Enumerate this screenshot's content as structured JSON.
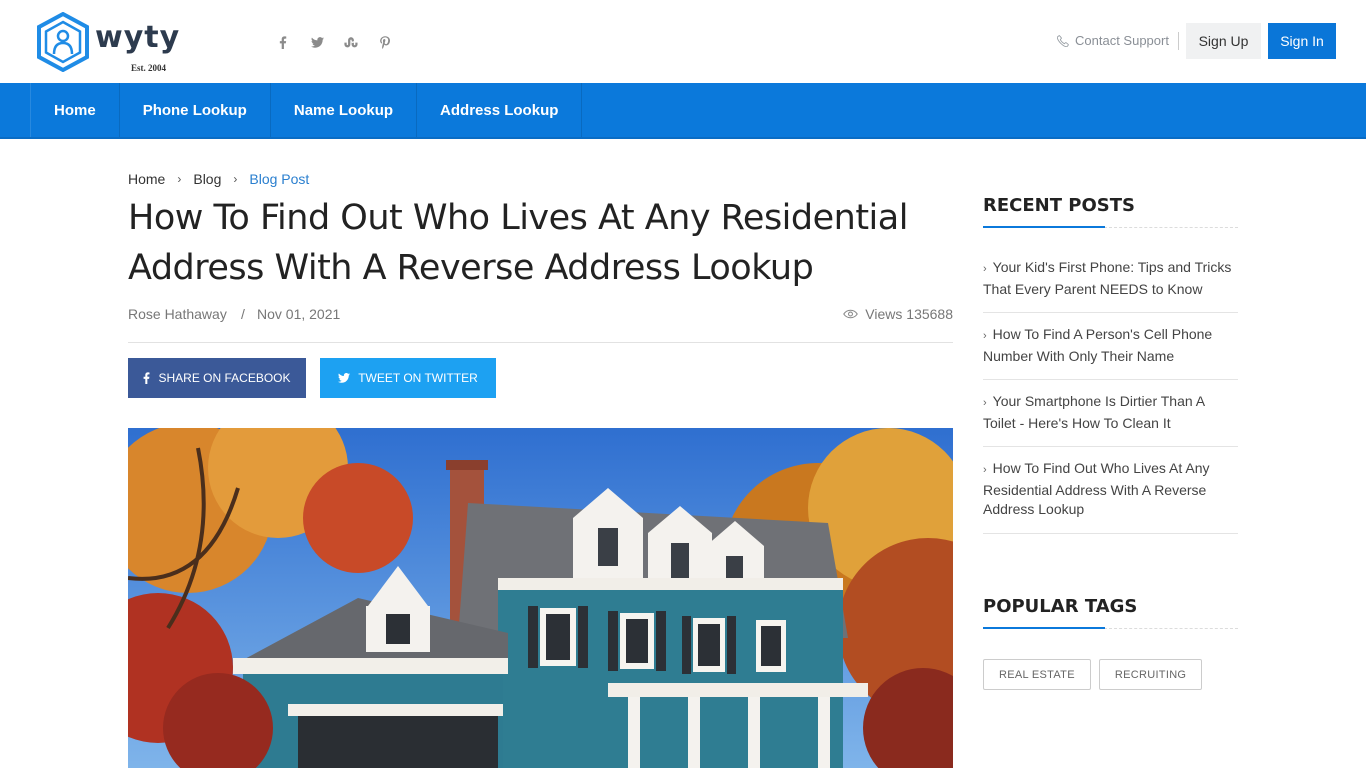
{
  "header": {
    "logo_text": "wyty",
    "logo_est": "Est. 2004",
    "socials": [
      "facebook-icon",
      "twitter-icon",
      "stumbleupon-icon",
      "pinterest-icon"
    ],
    "contact_label": "Contact Support",
    "signup_label": "Sign Up",
    "signin_label": "Sign In"
  },
  "nav": {
    "items": [
      {
        "label": "Home"
      },
      {
        "label": "Phone Lookup"
      },
      {
        "label": "Name Lookup"
      },
      {
        "label": "Address Lookup"
      }
    ]
  },
  "breadcrumb": {
    "items": [
      {
        "label": "Home"
      },
      {
        "label": "Blog"
      },
      {
        "label": "Blog Post"
      }
    ]
  },
  "article": {
    "title": "How To Find Out Who Lives At Any Residential Address With A Reverse Address Lookup",
    "author": "Rose Hathaway",
    "separator": "/",
    "date": "Nov 01, 2021",
    "views": "Views 135688",
    "share_facebook": "SHARE ON FACEBOOK",
    "share_twitter": "TWEET ON TWITTER"
  },
  "sidebar": {
    "recent_heading": "RECENT POSTS",
    "recent_posts": [
      {
        "title": "Your Kid's First Phone: Tips and Tricks That Every Parent NEEDS to Know"
      },
      {
        "title": "How To Find A Person's Cell Phone Number With Only Their Name"
      },
      {
        "title": "Your Smartphone Is Dirtier Than A Toilet - Here's How To Clean It"
      },
      {
        "title": "How To Find Out Who Lives At Any Residential Address With A Reverse Address Lookup"
      }
    ],
    "tags_heading": "POPULAR TAGS",
    "tags": [
      {
        "label": "REAL ESTATE"
      },
      {
        "label": "RECRUITING"
      }
    ]
  },
  "colors": {
    "brand_blue": "#0b79db",
    "facebook": "#3b5998",
    "twitter": "#1da1f2"
  }
}
